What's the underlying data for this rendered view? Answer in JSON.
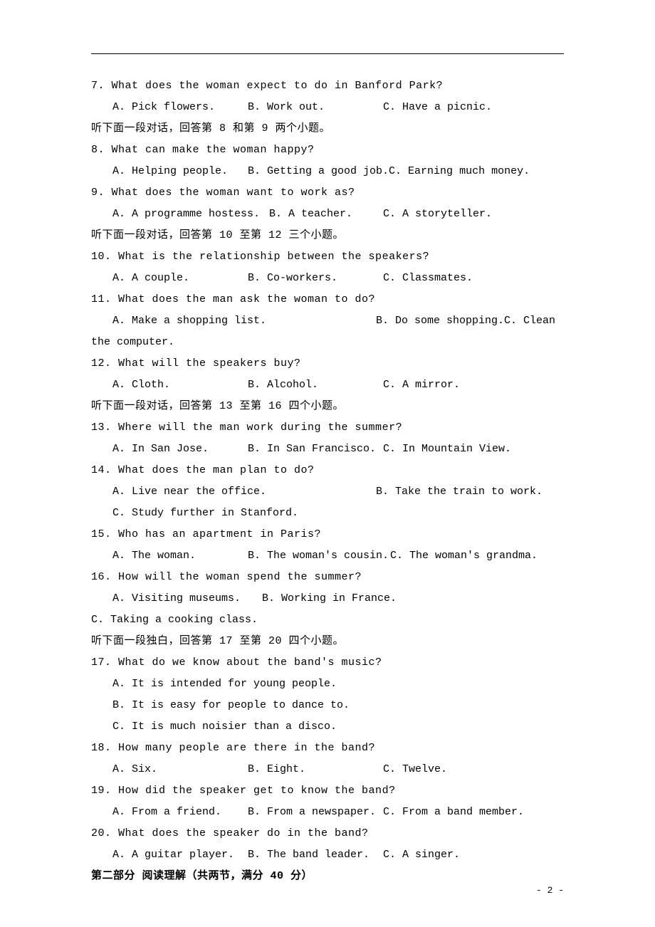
{
  "questions": [
    {
      "num": "7",
      "text": "What does the woman expect to do in Banford Park?",
      "a": "A. Pick flowers.",
      "b": "B. Work out.",
      "c": "C. Have a picnic."
    },
    {
      "instruction": "听下面一段对话，回答第 8 和第 9 两个小题。"
    },
    {
      "num": "8",
      "text": "What can make the woman happy?",
      "a": "A. Helping people.",
      "b": "B. Getting a good job.",
      "c": "C. Earning much money."
    },
    {
      "num": "9",
      "text": "What does the woman want to work as?",
      "a": "A. A programme hostess.",
      "b": "B. A teacher.",
      "c": "C. A storyteller."
    },
    {
      "instruction": "听下面一段对话，回答第 10 至第 12 三个小题。"
    },
    {
      "num": "10",
      "text": "What is the relationship between the speakers?",
      "a": "A. A couple.",
      "b": "B. Co-workers.",
      "c": "C. Classmates."
    },
    {
      "num": "11",
      "text": "What does the man ask the woman to do?",
      "a": "A. Make a shopping list.",
      "b": "B. Do some shopping.",
      "c": "C. Clean",
      "wrap": "the computer."
    },
    {
      "num": "12",
      "text": "What will the speakers buy?",
      "a": "A. Cloth.",
      "b": "B. Alcohol.",
      "c": "C. A mirror."
    },
    {
      "instruction": "听下面一段对话，回答第 13 至第 16 四个小题。"
    },
    {
      "num": "13",
      "text": "Where will the man work during the summer?",
      "a": "A. In San Jose.",
      "b": "B. In San Francisco.",
      "c": "C. In Mountain View."
    },
    {
      "num": "14",
      "text": "What does the man plan to do?",
      "a": "A. Live near the office.",
      "b": "B. Take the train to work.",
      "c": "C. Study further in Stanford."
    },
    {
      "num": "15",
      "text": "Who has an apartment in Paris?",
      "a": "A. The woman.",
      "b": "B. The woman's cousin.",
      "c": "C. The woman's grandma."
    },
    {
      "num": "16",
      "text": "How will the woman spend the summer?",
      "a": "A. Visiting museums.",
      "b": "B. Working in France.",
      "c": "C. Taking a cooking class."
    },
    {
      "instruction": "听下面一段独白，回答第 17 至第 20 四个小题。"
    },
    {
      "num": "17",
      "text": "What do we know about the band's music?",
      "a": "A. It is intended for young people.",
      "b": "B. It is easy for people to dance to.",
      "c": "C. It is much noisier than a disco.",
      "stacked": true
    },
    {
      "num": "18",
      "text": "How many people are there in the band?",
      "a": "A. Six.",
      "b": "B. Eight.",
      "c": "C. Twelve."
    },
    {
      "num": "19",
      "text": "How did the speaker get to know the band?",
      "a": "A. From a friend.",
      "b": "B. From a newspaper.",
      "c": "C. From a band member."
    },
    {
      "num": "20",
      "text": "What does the speaker do in the band?",
      "a": "A. A guitar player.",
      "b": "B. The band leader.",
      "c": "C. A singer."
    }
  ],
  "section_heading": "第二部分 阅读理解（共两节，满分 40 分）",
  "page_number": "- 2 -"
}
